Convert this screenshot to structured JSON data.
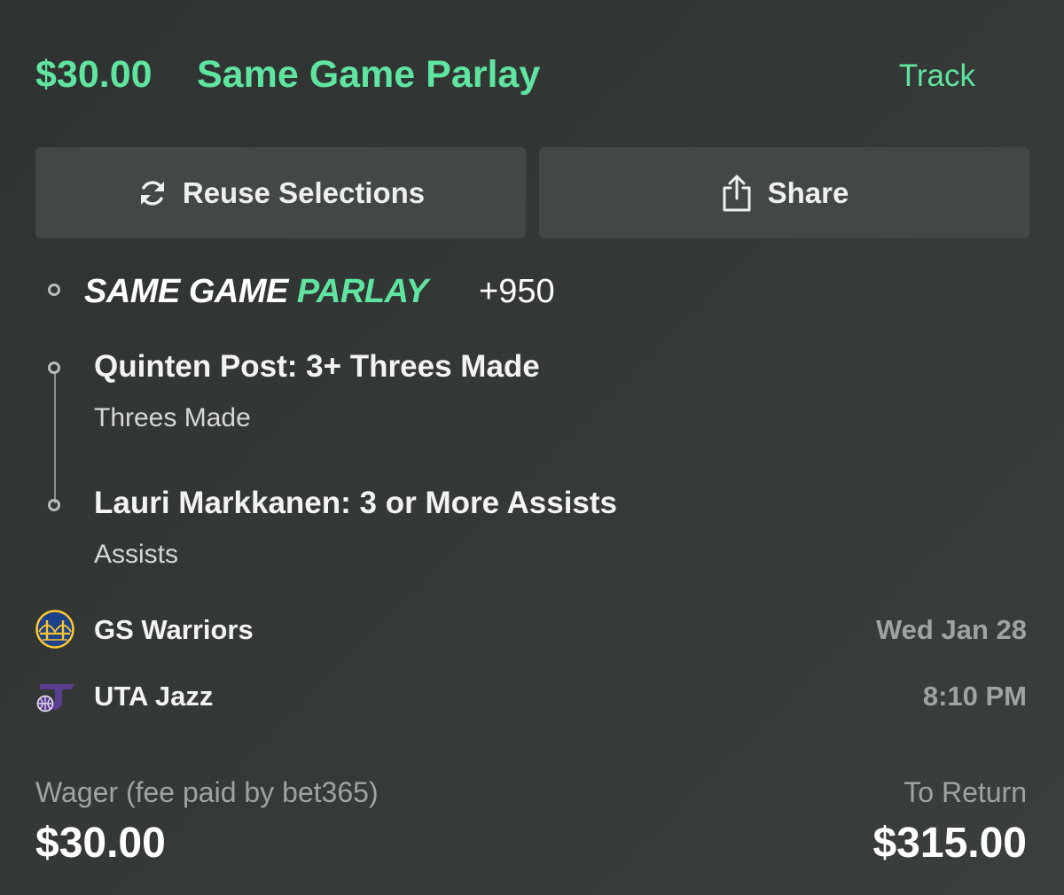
{
  "header": {
    "amount": "$30.00",
    "title": "Same Game Parlay",
    "track_label": "Track"
  },
  "actions": {
    "reuse_label": "Reuse Selections",
    "reuse_icon": "refresh-icon",
    "share_label": "Share",
    "share_icon": "share-icon"
  },
  "parlay": {
    "logo_part1": "SAME GAME",
    "logo_part2": "PARLAY",
    "odds": "+950"
  },
  "legs": [
    {
      "title": "Quinten Post: 3+ Threes Made",
      "market": "Threes Made"
    },
    {
      "title": "Lauri Markkanen: 3 or More Assists",
      "market": "Assists"
    }
  ],
  "game": {
    "teams": [
      {
        "name": "GS Warriors",
        "logo": "warriors-logo"
      },
      {
        "name": "UTA Jazz",
        "logo": "jazz-logo"
      }
    ],
    "date": "Wed Jan 28",
    "time": "8:10 PM"
  },
  "footer": {
    "wager_label": "Wager (fee paid by bet365)",
    "wager_value": "$30.00",
    "return_label": "To Return",
    "return_value": "$315.00"
  },
  "colors": {
    "accent": "#5fe5a0",
    "background": "#353937",
    "button": "#434846",
    "muted_text": "#9fa3a1"
  }
}
